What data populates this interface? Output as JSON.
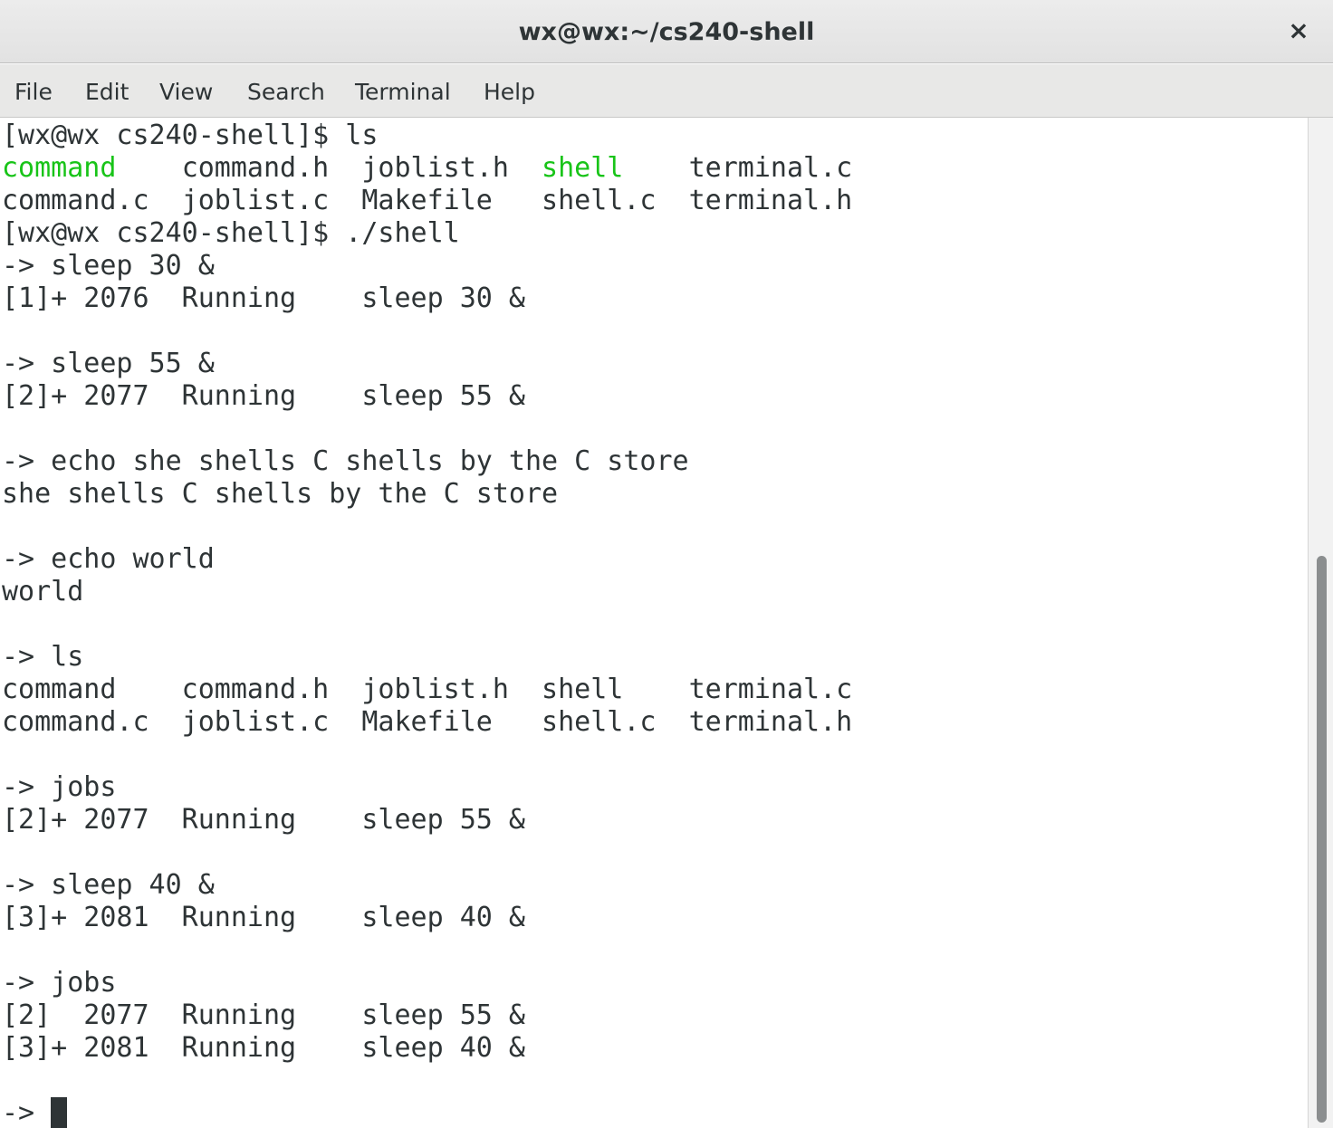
{
  "window": {
    "title": "wx@wx:~/cs240-shell",
    "close_icon": "×"
  },
  "menu": {
    "file": "File",
    "edit": "Edit",
    "view": "View",
    "search": "Search",
    "terminal": "Terminal",
    "help": "Help"
  },
  "terminal": {
    "lines": [
      "[wx@wx cs240-shell]$ ls",
      "",
      "command.c  joblist.c  Makefile   shell.c  terminal.h",
      "[wx@wx cs240-shell]$ ./shell",
      "-> sleep 30 &",
      "[1]+ 2076  Running    sleep 30 &",
      "",
      "-> sleep 55 &",
      "[2]+ 2077  Running    sleep 55 &",
      "",
      "-> echo she shells C shells by the C store",
      "she shells C shells by the C store",
      "",
      "-> echo world",
      "world",
      "",
      "-> ls",
      "command    command.h  joblist.h  shell    terminal.c",
      "command.c  joblist.c  Makefile   shell.c  terminal.h",
      "",
      "-> jobs",
      "[2]+ 2077  Running    sleep 55 &",
      "",
      "-> sleep 40 &",
      "[3]+ 2081  Running    sleep 40 &",
      "",
      "-> jobs",
      "[2]  2077  Running    sleep 55 &",
      "[3]+ 2081  Running    sleep 40 &",
      "",
      "-> "
    ],
    "colored_listing": {
      "exec1": "command",
      "pad1": "    ",
      "rest1": "command.h  joblist.h  ",
      "exec2": "shell",
      "rest2": "    terminal.c"
    },
    "executable_color": "#18c418",
    "text_color": "#2e3436",
    "background_color": "#ffffff"
  }
}
